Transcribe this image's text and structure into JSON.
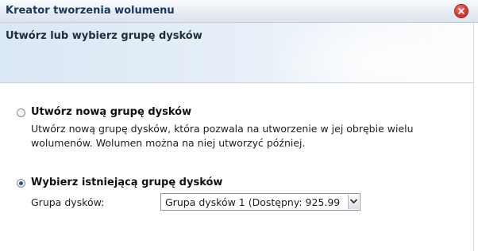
{
  "window": {
    "title": "Kreator tworzenia wolumenu"
  },
  "header": {
    "title": "Utwórz lub wybierz grupę dysków"
  },
  "options": {
    "create_new": {
      "label": "Utwórz nową grupę dysków",
      "description": "Utwórz nową grupę dysków, która pozwala na utworzenie w jej obrębie wielu wolumenów. Wolumen można na niej utworzyć później.",
      "selected": false
    },
    "choose_existing": {
      "label": "Wybierz istniejącą grupę dysków",
      "selected": true
    }
  },
  "disk_group": {
    "label": "Grupa dysków:",
    "selected_value": "Grupa dysków 1 (Dostępny: 925.99"
  },
  "icons": {
    "close": "close-icon",
    "dropdown": "chevron-down-icon"
  },
  "colors": {
    "title_text": "#15385e",
    "close_button": "#d8352b",
    "radio_checked": "#2c4f84"
  }
}
